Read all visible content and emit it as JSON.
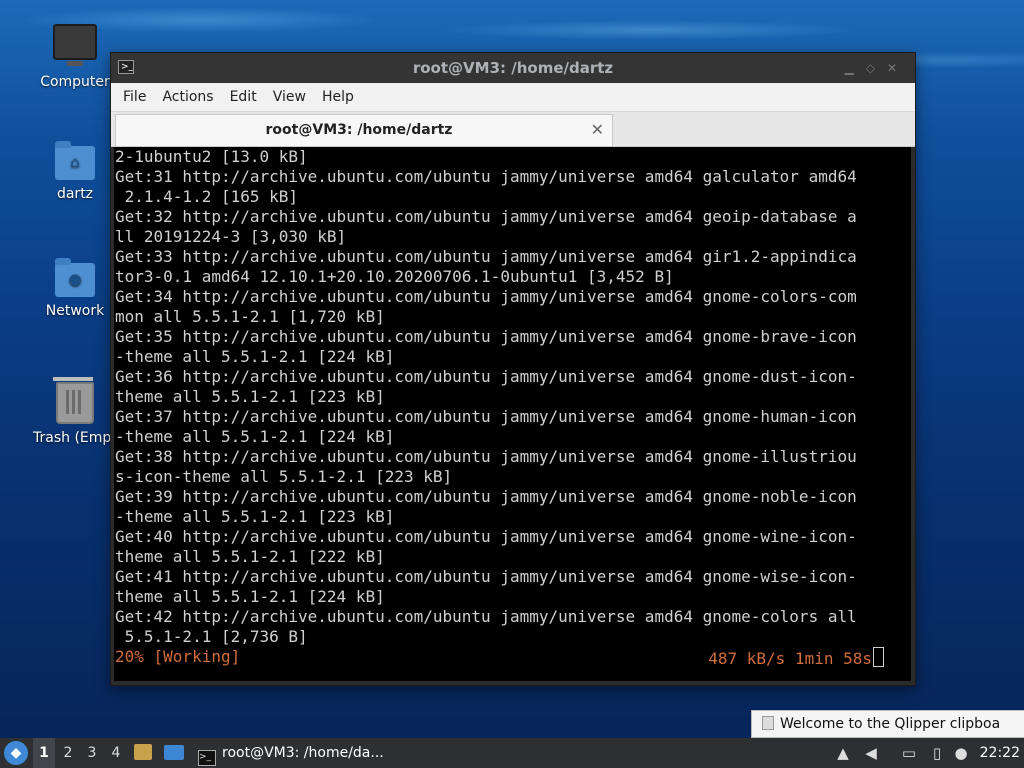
{
  "desktop": {
    "icons": [
      {
        "label": "Computer",
        "icon": "computer-icon"
      },
      {
        "label": "dartz",
        "icon": "home-folder-icon"
      },
      {
        "label": "Network",
        "icon": "network-folder-icon"
      },
      {
        "label": "Trash (Empty)",
        "icon": "trash-icon"
      }
    ]
  },
  "window": {
    "title": "root@VM3: /home/dartz",
    "menu": [
      "File",
      "Actions",
      "Edit",
      "View",
      "Help"
    ],
    "tab": {
      "label": "root@VM3: /home/dartz",
      "close": "✕"
    }
  },
  "terminal": {
    "lines": [
      "2-1ubuntu2 [13.0 kB]",
      "Get:31 http://archive.ubuntu.com/ubuntu jammy/universe amd64 galculator amd64",
      " 2.1.4-1.2 [165 kB]",
      "Get:32 http://archive.ubuntu.com/ubuntu jammy/universe amd64 geoip-database a",
      "ll 20191224-3 [3,030 kB]",
      "Get:33 http://archive.ubuntu.com/ubuntu jammy/universe amd64 gir1.2-appindica",
      "tor3-0.1 amd64 12.10.1+20.10.20200706.1-0ubuntu1 [3,452 B]",
      "Get:34 http://archive.ubuntu.com/ubuntu jammy/universe amd64 gnome-colors-com",
      "mon all 5.5.1-2.1 [1,720 kB]",
      "Get:35 http://archive.ubuntu.com/ubuntu jammy/universe amd64 gnome-brave-icon",
      "-theme all 5.5.1-2.1 [224 kB]",
      "Get:36 http://archive.ubuntu.com/ubuntu jammy/universe amd64 gnome-dust-icon-",
      "theme all 5.5.1-2.1 [223 kB]",
      "Get:37 http://archive.ubuntu.com/ubuntu jammy/universe amd64 gnome-human-icon",
      "-theme all 5.5.1-2.1 [224 kB]",
      "Get:38 http://archive.ubuntu.com/ubuntu jammy/universe amd64 gnome-illustriou",
      "s-icon-theme all 5.5.1-2.1 [223 kB]",
      "Get:39 http://archive.ubuntu.com/ubuntu jammy/universe amd64 gnome-noble-icon",
      "-theme all 5.5.1-2.1 [223 kB]",
      "Get:40 http://archive.ubuntu.com/ubuntu jammy/universe amd64 gnome-wine-icon-",
      "theme all 5.5.1-2.1 [222 kB]",
      "Get:41 http://archive.ubuntu.com/ubuntu jammy/universe amd64 gnome-wise-icon-",
      "theme all 5.5.1-2.1 [224 kB]",
      "Get:42 http://archive.ubuntu.com/ubuntu jammy/universe amd64 gnome-colors all",
      " 5.5.1-2.1 [2,736 B]"
    ],
    "status_left": "20% [Working]",
    "status_right": "487 kB/s 1min 58s",
    "status_color": "#d06d3c"
  },
  "notification": {
    "text": "Welcome to the Qlipper clipboa"
  },
  "taskbar": {
    "workspaces": [
      "1",
      "2",
      "3",
      "4"
    ],
    "active_workspace": "1",
    "task_label": "root@VM3: /home/da...",
    "clock": "22:22",
    "tray_icons": [
      "updates-icon",
      "volume-icon",
      "network-icon",
      "clipboard-icon",
      "notification-icon"
    ]
  }
}
